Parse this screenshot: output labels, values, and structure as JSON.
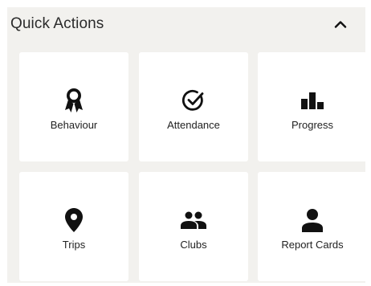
{
  "quick_actions": {
    "title": "Quick Actions",
    "collapse_icon": "chevron-up-icon",
    "items": [
      {
        "label": "Behaviour",
        "icon": "award-ribbon-icon"
      },
      {
        "label": "Attendance",
        "icon": "check-circle-icon"
      },
      {
        "label": "Progress",
        "icon": "bar-chart-icon"
      },
      {
        "label": "Trips",
        "icon": "map-pin-icon"
      },
      {
        "label": "Clubs",
        "icon": "people-group-icon"
      },
      {
        "label": "Report Cards",
        "icon": "person-icon"
      }
    ]
  },
  "colors": {
    "panel_background": "#f2f1ee",
    "card_background": "#ffffff",
    "icon": "#111111",
    "text": "#222222"
  }
}
